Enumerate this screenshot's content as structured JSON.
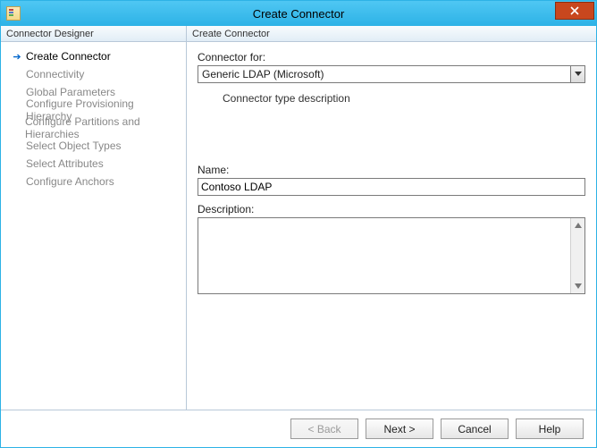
{
  "window": {
    "title": "Create Connector"
  },
  "columns": {
    "left_header": "Connector Designer",
    "right_header": "Create Connector"
  },
  "nav": {
    "items": [
      {
        "label": "Create Connector",
        "name": "create-connector",
        "active": true
      },
      {
        "label": "Connectivity",
        "name": "connectivity"
      },
      {
        "label": "Global Parameters",
        "name": "global-parameters"
      },
      {
        "label": "Configure Provisioning Hierarchy",
        "name": "configure-provisioning-hierarchy"
      },
      {
        "label": "Configure Partitions and Hierarchies",
        "name": "configure-partitions"
      },
      {
        "label": "Select Object Types",
        "name": "select-object-types"
      },
      {
        "label": "Select Attributes",
        "name": "select-attributes"
      },
      {
        "label": "Configure Anchors",
        "name": "configure-anchors"
      }
    ]
  },
  "form": {
    "connector_for_label": "Connector for:",
    "connector_for_value": "Generic LDAP (Microsoft)",
    "type_description": "Connector type description",
    "name_label": "Name:",
    "name_value": "Contoso LDAP",
    "description_label": "Description:",
    "description_value": ""
  },
  "buttons": {
    "back": "<  Back",
    "next": "Next  >",
    "cancel": "Cancel",
    "help": "Help"
  }
}
